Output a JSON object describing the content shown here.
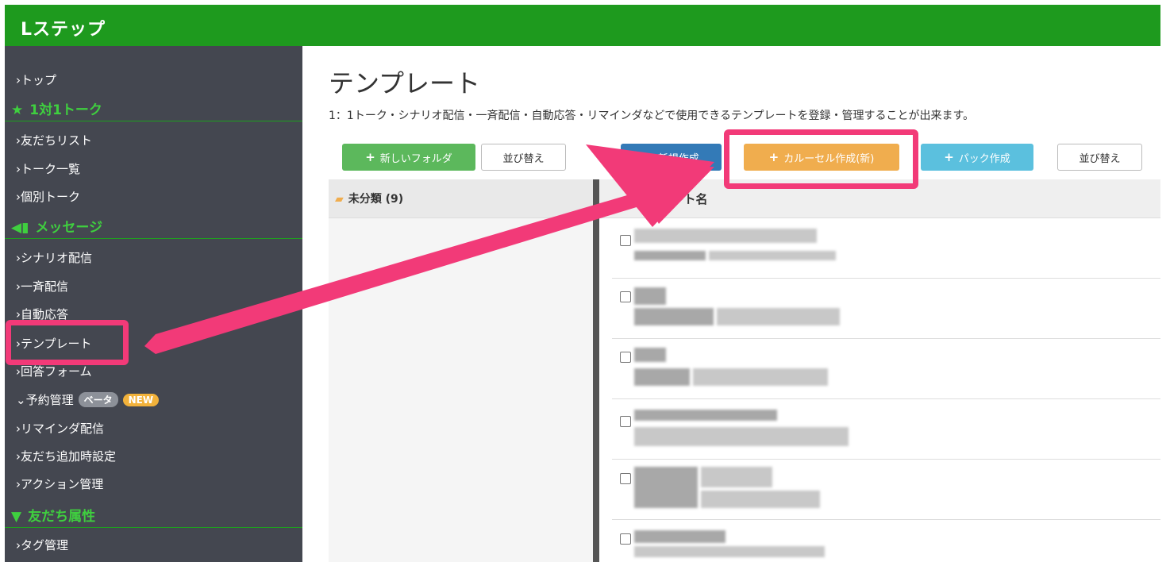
{
  "app": {
    "brand": "Lステップ"
  },
  "sidebar": {
    "top": "トップ",
    "section_talk": {
      "icon": "star-icon",
      "label": "1対1トーク"
    },
    "talk_items": [
      "友だちリスト",
      "トーク一覧",
      "個別トーク"
    ],
    "section_message": {
      "icon": "megaphone-icon",
      "label": "メッセージ"
    },
    "message_items": [
      "シナリオ配信",
      "一斉配信",
      "自動応答",
      "テンプレート",
      "回答フォーム"
    ],
    "reservation": {
      "label": "予約管理",
      "badge_beta": "ベータ",
      "badge_new": "NEW"
    },
    "more_items": [
      "リマインダ配信",
      "友だち追加時設定",
      "アクション管理"
    ],
    "section_friend": {
      "icon": "filter-icon",
      "label": "友だち属性"
    },
    "friend_items": [
      "タグ管理"
    ]
  },
  "main": {
    "title": "テンプレート",
    "description": "1：1トーク・シナリオ配信・一斉配信・自動応答・リマインダなどで使用できるテンプレートを登録・管理することが出来ます。",
    "buttons": {
      "new_folder": "新しいフォルダ",
      "sort_folders": "並び替え",
      "new_create": "新規作成",
      "carousel": "カルーセル作成(新)",
      "pack": "パック作成",
      "sort_templates": "並び替え"
    },
    "folder": {
      "label": "未分類 (9)"
    },
    "list": {
      "header": "テンプレート名"
    }
  },
  "colors": {
    "topbar": "#1e9a1e",
    "sidebar": "#444750",
    "section_green": "#3fcf3f",
    "highlight": "#f23a78"
  }
}
